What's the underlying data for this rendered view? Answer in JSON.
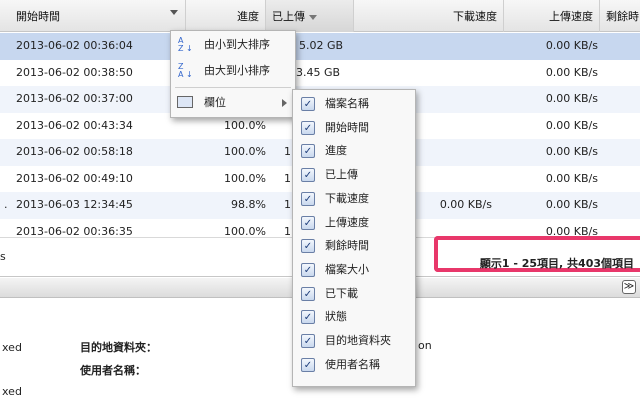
{
  "table": {
    "columns": [
      {
        "label": "開始時間"
      },
      {
        "label": "進度"
      },
      {
        "label": "已上傳"
      },
      {
        "label": "下載速度"
      },
      {
        "label": "上傳速度"
      },
      {
        "label": "剩餘時"
      }
    ],
    "rows": [
      {
        "prefix": "",
        "start": "2013-06-02 00:36:04",
        "progress": "",
        "uploaded": "5.02 GB",
        "down": "",
        "up": "0.00 KB/s"
      },
      {
        "prefix": "",
        "start": "2013-06-02 00:38:50",
        "progress": "",
        "uploaded": "3.45 GB",
        "down": "",
        "up": "0.00 KB/s"
      },
      {
        "prefix": "",
        "start": "2013-06-02 00:37:00",
        "progress": "",
        "uploaded": "",
        "down": "",
        "up": "0.00 KB/s"
      },
      {
        "prefix": "",
        "start": "2013-06-02 00:43:34",
        "progress": "100.0%",
        "uploaded": "",
        "down": "",
        "up": "0.00 KB/s"
      },
      {
        "prefix": "",
        "start": "2013-06-02 00:58:18",
        "progress": "100.0%",
        "uploaded": "1",
        "down": "",
        "up": "0.00 KB/s"
      },
      {
        "prefix": "",
        "start": "2013-06-02 00:49:10",
        "progress": "100.0%",
        "uploaded": "1",
        "down": "",
        "up": "0.00 KB/s"
      },
      {
        "prefix": ".",
        "start": "2013-06-03 12:34:45",
        "progress": "98.8%",
        "uploaded": "1",
        "down": "0.00 KB/s",
        "up": "0.00 KB/s"
      },
      {
        "prefix": "",
        "start": "2013-06-02 00:36:35",
        "progress": "100.0%",
        "uploaded": "1",
        "down": "",
        "up": "0.00 KB/s"
      }
    ]
  },
  "footer": {
    "left_text": "s",
    "info": "顯示1 - 25項目, 共403個項目"
  },
  "details": {
    "left1": "xed",
    "left2": "xed",
    "dest_label": "目的地資料夾：",
    "user_label": "使用者名稱：",
    "right_partial": "on"
  },
  "context_menu": {
    "sort_asc": "由小到大排序",
    "sort_desc": "由大到小排序",
    "columns": "欄位"
  },
  "columns_submenu": [
    {
      "label": "檔案名稱",
      "checked": true
    },
    {
      "label": "開始時間",
      "checked": true
    },
    {
      "label": "進度",
      "checked": true
    },
    {
      "label": "已上傳",
      "checked": true
    },
    {
      "label": "下載速度",
      "checked": true
    },
    {
      "label": "上傳速度",
      "checked": true
    },
    {
      "label": "剩餘時間",
      "checked": true
    },
    {
      "label": "檔案大小",
      "checked": true
    },
    {
      "label": "已下載",
      "checked": true
    },
    {
      "label": "狀態",
      "checked": true
    },
    {
      "label": "目的地資料夾",
      "checked": true
    },
    {
      "label": "使用者名稱",
      "checked": true
    }
  ],
  "icons": {
    "sort_asc": "sort-ascending-icon",
    "sort_desc": "sort-descending-icon",
    "columns": "columns-icon",
    "collapse": "collapse-panel-icon"
  },
  "colors": {
    "selected_row": "#c7d7ef",
    "highlight_box": "#e8376a"
  }
}
